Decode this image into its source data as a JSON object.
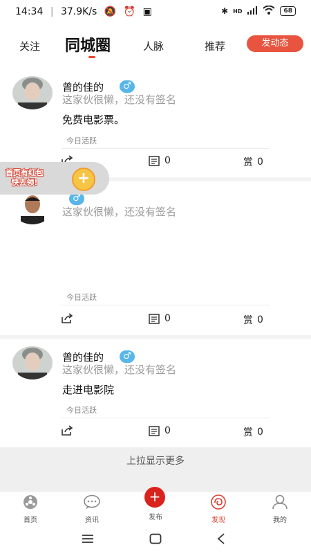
{
  "status_bar": {
    "time": "14:34",
    "speed": "37.9K/s",
    "network": "HD",
    "battery": "68"
  },
  "top_nav": {
    "tabs": [
      {
        "label": "关注"
      },
      {
        "label": "同城圈"
      },
      {
        "label": "人脉"
      },
      {
        "label": "推荐"
      }
    ],
    "active_tab": "同城圈",
    "post_button": "发动态",
    "accent_color": "#e8543f"
  },
  "posts": [
    {
      "username": "曾的佳的",
      "gender": "♂",
      "signature": "这家伙很懒，还没有签名",
      "content": "免费电影票。",
      "activity": "今日活跃",
      "comments": "0",
      "rewards": "0",
      "reward_label": "赏"
    },
    {
      "username": "",
      "gender": "♂",
      "signature": "这家伙很懒，还没有签名",
      "content": "",
      "activity": "今日活跃",
      "comments": "0",
      "rewards": "0",
      "reward_label": "赏"
    },
    {
      "username": "曾的佳的",
      "gender": "♂",
      "signature": "这家伙很懒，还没有签名",
      "content": "走进电影院",
      "activity": "今日活跃",
      "comments": "0",
      "rewards": "0",
      "reward_label": "赏"
    }
  ],
  "red_packet": {
    "line1": "首页有红包",
    "line2": "快去领!",
    "icon": "+"
  },
  "load_more": "上拉显示更多",
  "bottom_nav": {
    "items": [
      {
        "label": "首页",
        "icon": "home-icon"
      },
      {
        "label": "资讯",
        "icon": "chat-icon"
      },
      {
        "label": "发布",
        "icon": "publish-icon"
      },
      {
        "label": "发现",
        "icon": "discover-icon"
      },
      {
        "label": "我的",
        "icon": "profile-icon"
      }
    ],
    "active": "发现",
    "active_color": "#d9402f"
  }
}
